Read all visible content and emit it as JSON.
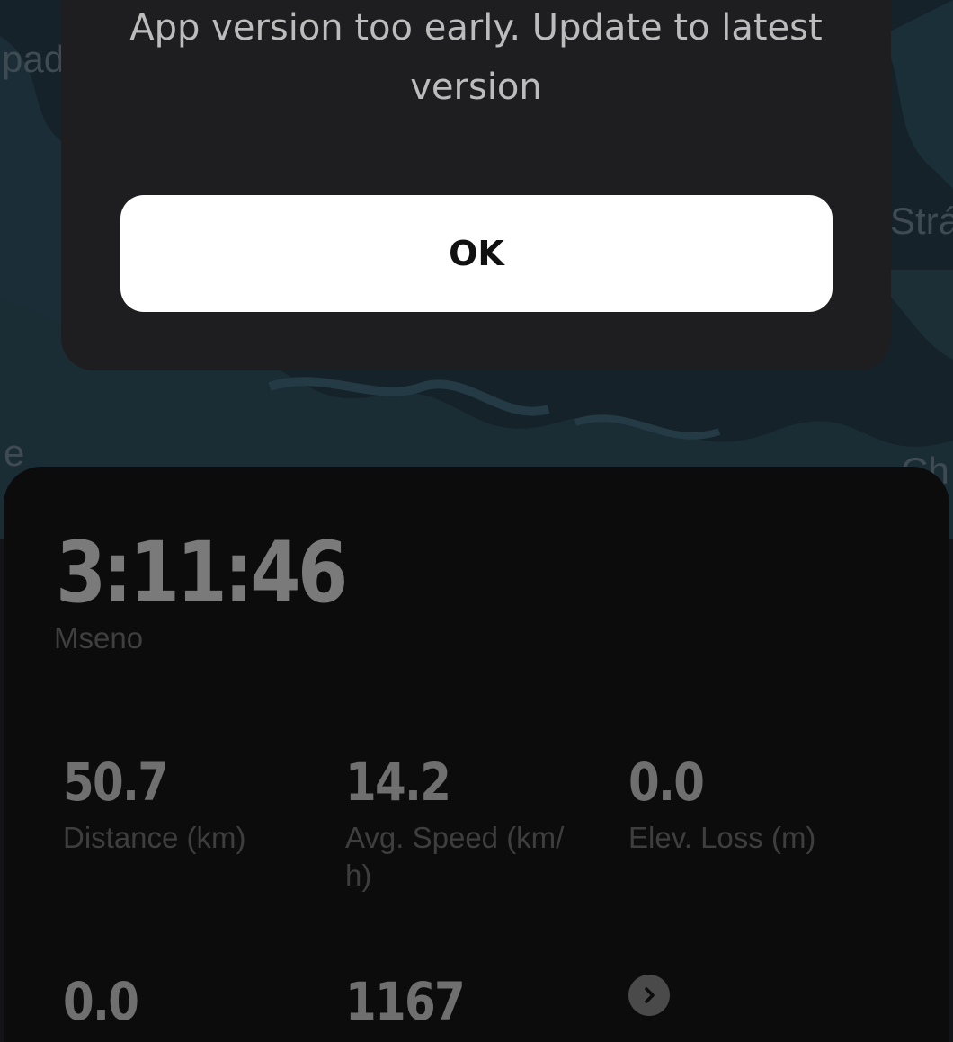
{
  "map": {
    "labels": [
      "pad",
      "e",
      "Strá",
      "Ch"
    ]
  },
  "dialog": {
    "message": "App version too early. Update to latest version",
    "ok_label": "OK"
  },
  "activity": {
    "duration": "3:11:46",
    "place": "Mseno",
    "stats": [
      {
        "value": "50.7",
        "label": "Distance (km)"
      },
      {
        "value": "14.2",
        "label": "Avg. Speed (km/ h)"
      },
      {
        "value": "0.0",
        "label": "Elev. Loss (m)"
      },
      {
        "value": "0.0",
        "label": ""
      },
      {
        "value": "1167",
        "label": ""
      }
    ],
    "more_icon": "chevron-right-icon"
  },
  "colors": {
    "background": "#121417",
    "dialog": "#1e1e20",
    "button": "#ffffff"
  }
}
